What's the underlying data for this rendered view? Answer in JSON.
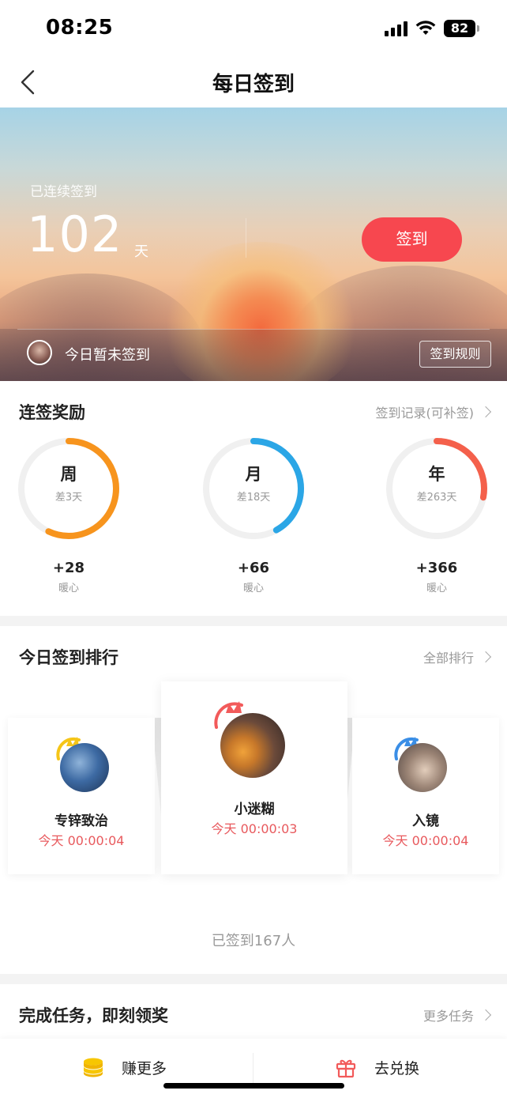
{
  "status_bar": {
    "time": "08:25",
    "battery": "82"
  },
  "nav": {
    "title": "每日签到"
  },
  "hero": {
    "streak_label": "已连续签到",
    "streak_days": "102",
    "streak_unit": "天",
    "checkin_button": "签到",
    "today_status": "今日暂未签到",
    "rules_button": "签到规则"
  },
  "rewards": {
    "title": "连签奖励",
    "record_link": "签到记录(可补签)",
    "items": [
      {
        "period": "周",
        "remaining": "差3天",
        "amount": "+28",
        "unit": "暖心",
        "progress": 0.57,
        "color": "#f7941d"
      },
      {
        "period": "月",
        "remaining": "差18天",
        "amount": "+66",
        "unit": "暖心",
        "progress": 0.42,
        "color": "#2ba6e6"
      },
      {
        "period": "年",
        "remaining": "差263天",
        "amount": "+366",
        "unit": "暖心",
        "progress": 0.28,
        "color": "#f4604b"
      }
    ]
  },
  "ranking": {
    "title": "今日签到排行",
    "all_link": "全部排行",
    "first": {
      "name": "小迷糊",
      "time": "今天 00:00:03"
    },
    "second": {
      "name": "专锌致治",
      "time": "今天 00:00:04"
    },
    "third": {
      "name": "入镜",
      "time": "今天 00:00:04"
    },
    "count_text": "已签到167人"
  },
  "tasks": {
    "title": "完成任务，即刻领奖",
    "more_link": "更多任务"
  },
  "bottom_bar": {
    "earn_more": "赚更多",
    "redeem": "去兑换"
  }
}
